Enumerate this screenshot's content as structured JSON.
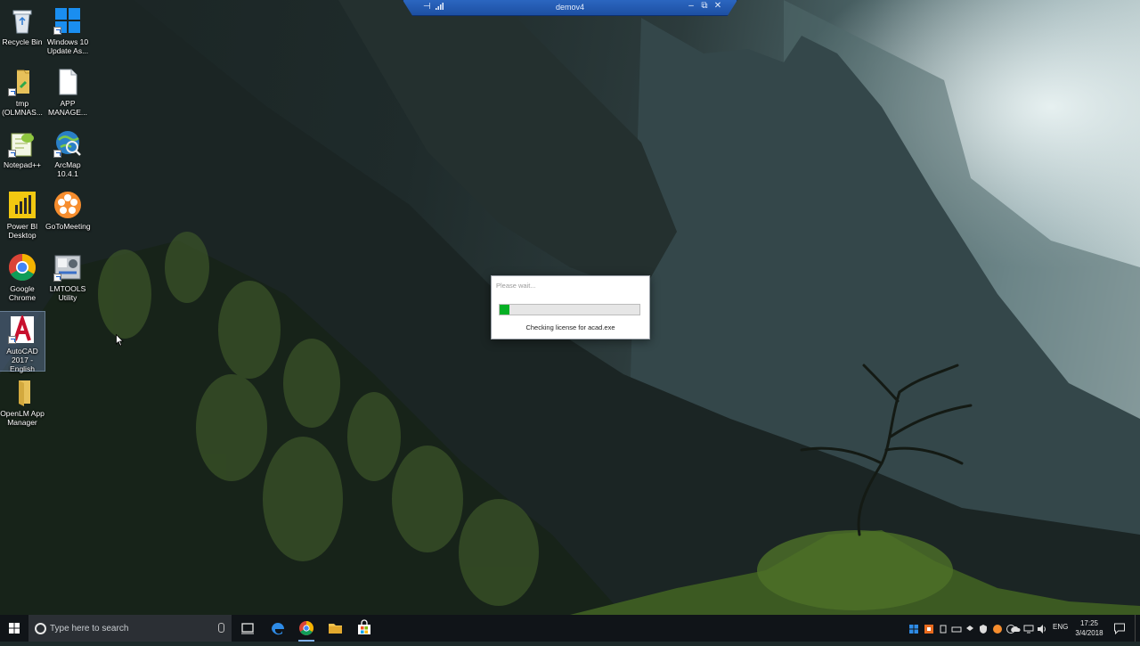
{
  "remote_session": {
    "title": "demov4",
    "pin_icon": "pin-icon",
    "signal_icon": "signal-icon",
    "minimize_label": "–",
    "restore_label": "⧉",
    "close_label": "✕"
  },
  "desktop_icons": [
    {
      "label": "Recycle Bin",
      "icon": "recycle-bin-icon"
    },
    {
      "label": "Windows 10 Update As...",
      "icon": "windows-update-icon"
    },
    {
      "label": "tmp (OLMNAS...",
      "icon": "folder-icon"
    },
    {
      "label": "APP MANAGE...",
      "icon": "document-icon"
    },
    {
      "label": "Notepad++",
      "icon": "notepad-plus-plus-icon"
    },
    {
      "label": "ArcMap 10.4.1",
      "icon": "arcmap-icon"
    },
    {
      "label": "Power BI Desktop",
      "icon": "power-bi-icon"
    },
    {
      "label": "GoToMeeting",
      "icon": "gotomeeting-icon"
    },
    {
      "label": "Google Chrome",
      "icon": "chrome-icon"
    },
    {
      "label": "LMTOOLS Utility",
      "icon": "lmtools-icon"
    },
    {
      "label": "AutoCAD 2017 - English",
      "icon": "autocad-icon"
    },
    {
      "label": "OpenLM App Manager",
      "icon": "folder-icon"
    }
  ],
  "dialog": {
    "title": "Please wait...",
    "progress": 0.07,
    "status": "Checking license for acad.exe"
  },
  "taskbar": {
    "search_placeholder": "Type here to search",
    "apps": [
      "task-view-icon",
      "edge-icon",
      "chrome-icon",
      "file-explorer-icon",
      "store-icon"
    ],
    "language": "ENG",
    "time": "17:25",
    "date": "3/4/2018"
  },
  "colors": {
    "accent": "#1d4fa2",
    "progress_fill": "#06b025",
    "taskbar": "#101418"
  }
}
